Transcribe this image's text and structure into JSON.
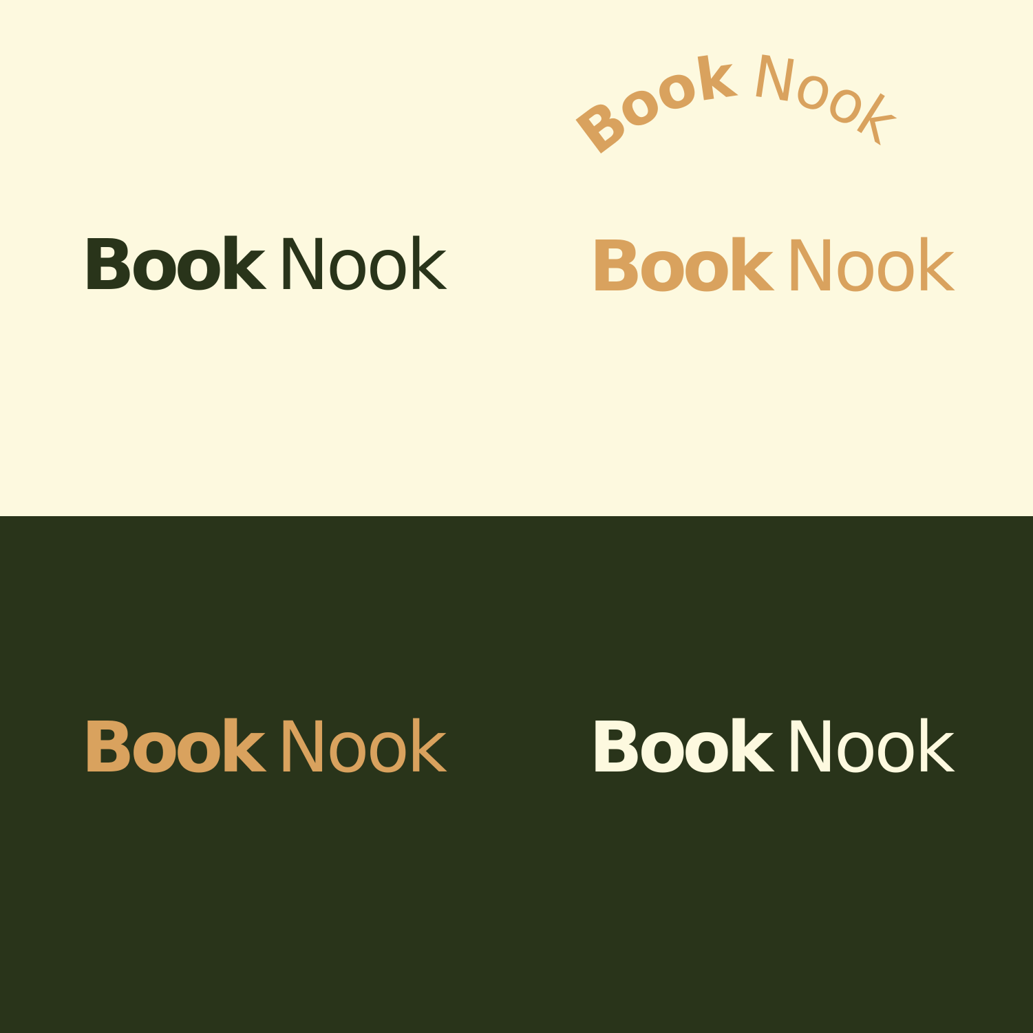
{
  "brand": {
    "word1": "Book",
    "word2": "Nook"
  },
  "colors": {
    "cream": "#FDF9DF",
    "dark_green": "#29341A",
    "gold": "#D9A25E",
    "off_white": "#FDF9DF"
  },
  "variants": [
    {
      "id": "dark-on-cream",
      "background": "cream",
      "text_color": "dark_green",
      "style": "straight"
    },
    {
      "id": "gold-arc-on-cream",
      "background": "cream",
      "text_color": "gold",
      "style": "arched"
    },
    {
      "id": "gold-on-cream",
      "background": "cream",
      "text_color": "gold",
      "style": "straight"
    },
    {
      "id": "gold-on-green",
      "background": "dark_green",
      "text_color": "gold",
      "style": "straight"
    },
    {
      "id": "cream-on-green",
      "background": "dark_green",
      "text_color": "off_white",
      "style": "straight"
    }
  ]
}
